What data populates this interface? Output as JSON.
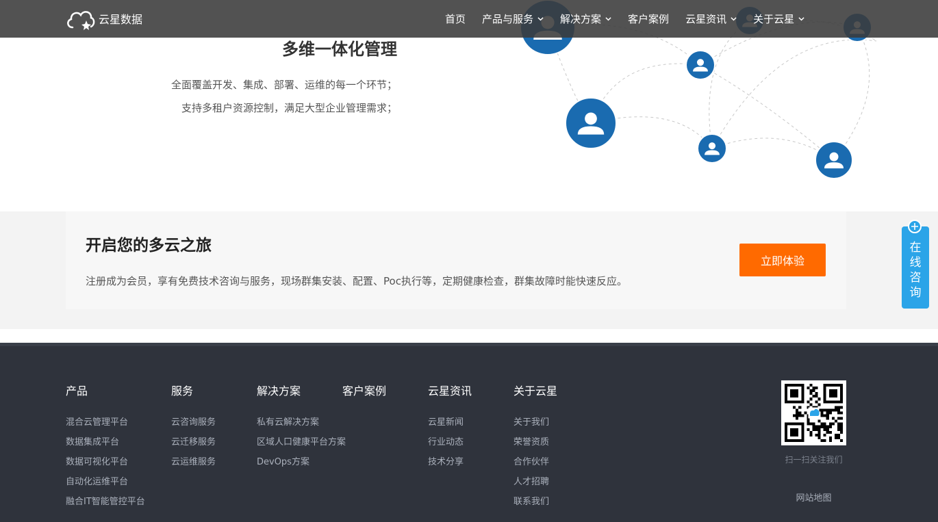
{
  "brand": {
    "name": "云星数据",
    "logo_icon": "cloud-star-icon"
  },
  "nav": {
    "items": [
      {
        "label": "首页",
        "has_dropdown": false
      },
      {
        "label": "产品与服务",
        "has_dropdown": true
      },
      {
        "label": "解决方案",
        "has_dropdown": true
      },
      {
        "label": "客户案例",
        "has_dropdown": false
      },
      {
        "label": "云星资讯",
        "has_dropdown": true
      },
      {
        "label": "关于云星",
        "has_dropdown": true
      }
    ]
  },
  "feature": {
    "title": "多维一体化管理",
    "lines": [
      "全面覆盖开发、集成、部署、运维的每一个环节；",
      "支持多租户资源控制，满足大型企业管理需求；"
    ],
    "illustration_icon": "user-network-icon"
  },
  "cta": {
    "title": "开启您的多云之旅",
    "description": "注册成为会员，享有免费技术咨询与服务，现场群集安装、配置、Poc执行等，定期健康检查，群集故障时能快速反应。",
    "button_label": "立即体验"
  },
  "footer": {
    "columns": [
      {
        "title": "产品",
        "links": [
          "混合云管理平台",
          "数据集成平台",
          "数据可视化平台",
          "自动化运维平台",
          "融合IT智能管控平台"
        ]
      },
      {
        "title": "服务",
        "links": [
          "云咨询服务",
          "云迁移服务",
          "云运维服务"
        ]
      },
      {
        "title": "解决方案",
        "links": [
          "私有云解决方案",
          "区域人口健康平台方案",
          "DevOps方案"
        ]
      },
      {
        "title": "客户案例",
        "links": []
      },
      {
        "title": "云星资讯",
        "links": [
          "云星新闻",
          "行业动态",
          "技术分享"
        ]
      },
      {
        "title": "关于云星",
        "links": [
          "关于我们",
          "荣誉资质",
          "合作伙伴",
          "人才招聘",
          "联系我们"
        ]
      }
    ],
    "qr_caption": "扫一扫关注我们",
    "sitemap_label": "网站地图"
  },
  "consult": {
    "label": "在线咨询",
    "icon": "plus-circle-icon"
  },
  "colors": {
    "nav_bg": "#3a3a3a",
    "accent_orange": "#ff6a00",
    "node_blue": "#1a6bb0",
    "consult_blue": "#2ba4e8",
    "footer_bg": "#2f333c"
  }
}
